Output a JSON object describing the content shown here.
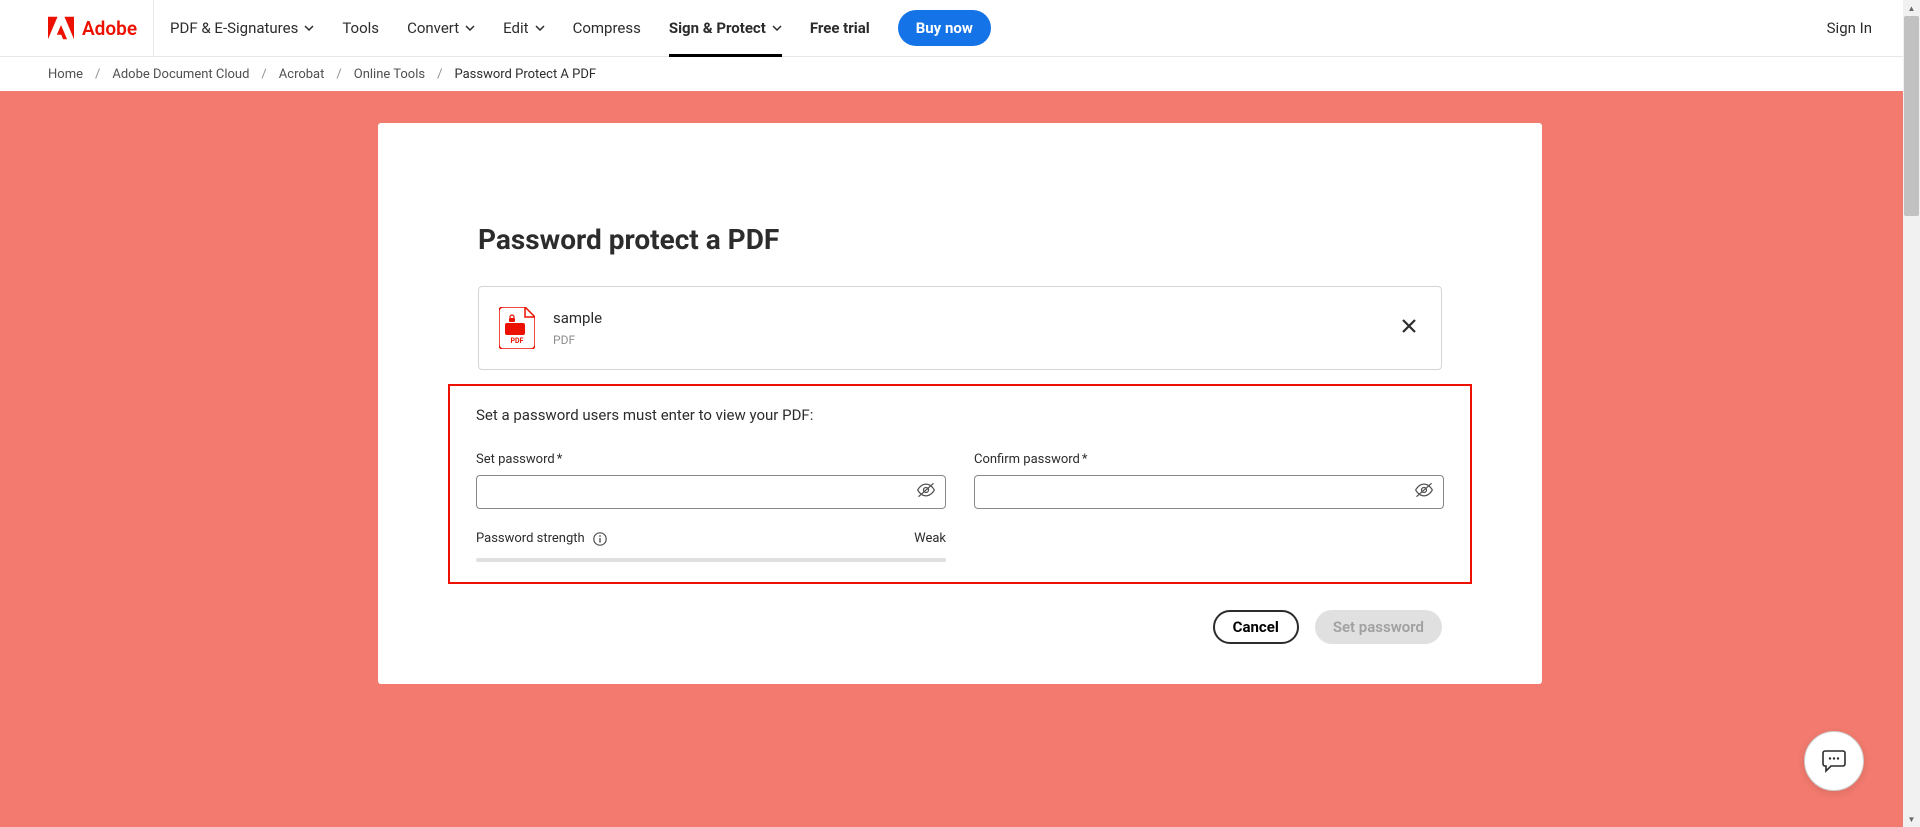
{
  "header": {
    "brand": "Adobe",
    "nav": {
      "pdf_esign": "PDF & E-Signatures",
      "tools": "Tools",
      "convert": "Convert",
      "edit": "Edit",
      "compress": "Compress",
      "sign_protect": "Sign & Protect",
      "free_trial": "Free trial",
      "buy_now": "Buy now",
      "sign_in": "Sign In"
    }
  },
  "breadcrumb": {
    "home": "Home",
    "doc_cloud": "Adobe Document Cloud",
    "acrobat": "Acrobat",
    "online_tools": "Online Tools",
    "current": "Password Protect A PDF"
  },
  "main": {
    "title": "Password protect a PDF",
    "file": {
      "name": "sample",
      "type": "PDF"
    },
    "prompt": "Set a password users must enter to view your PDF:",
    "set_password_label": "Set password",
    "confirm_password_label": "Confirm password",
    "strength_label": "Password strength",
    "strength_value": "Weak",
    "cancel": "Cancel",
    "submit": "Set password"
  }
}
